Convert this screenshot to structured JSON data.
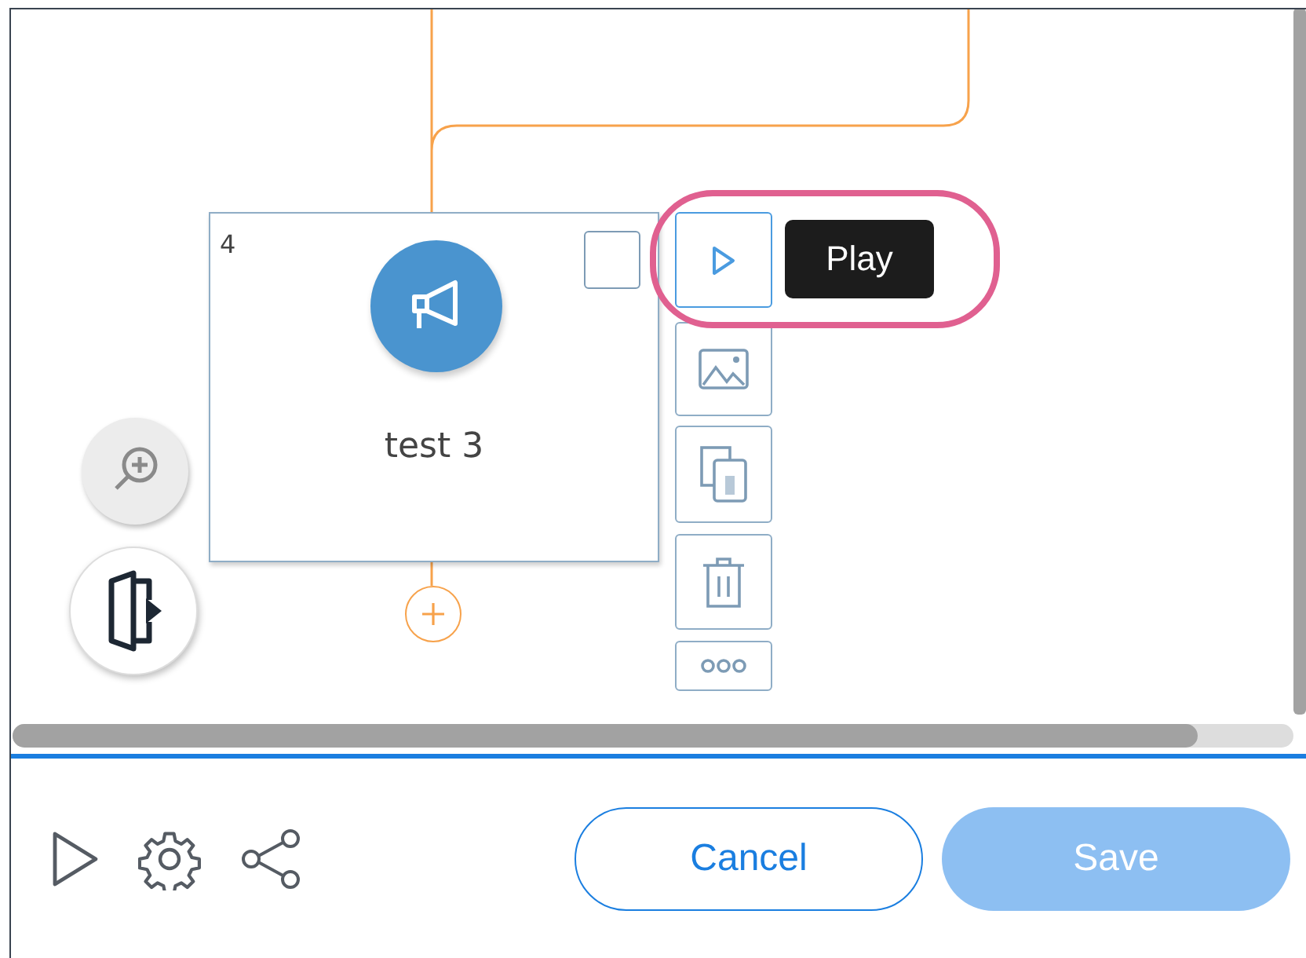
{
  "node": {
    "number": "4",
    "title": "test 3",
    "checked": false
  },
  "node_actions": [
    {
      "kind": "play",
      "selected": true
    },
    {
      "kind": "image",
      "selected": false
    },
    {
      "kind": "copy",
      "selected": false
    },
    {
      "kind": "delete",
      "selected": false
    },
    {
      "kind": "more",
      "selected": false
    }
  ],
  "tooltip": {
    "text": "Play"
  },
  "footer": {
    "buttons": [
      {
        "label": "Cancel",
        "disabled": false
      },
      {
        "label": "Save",
        "disabled": true
      }
    ]
  }
}
